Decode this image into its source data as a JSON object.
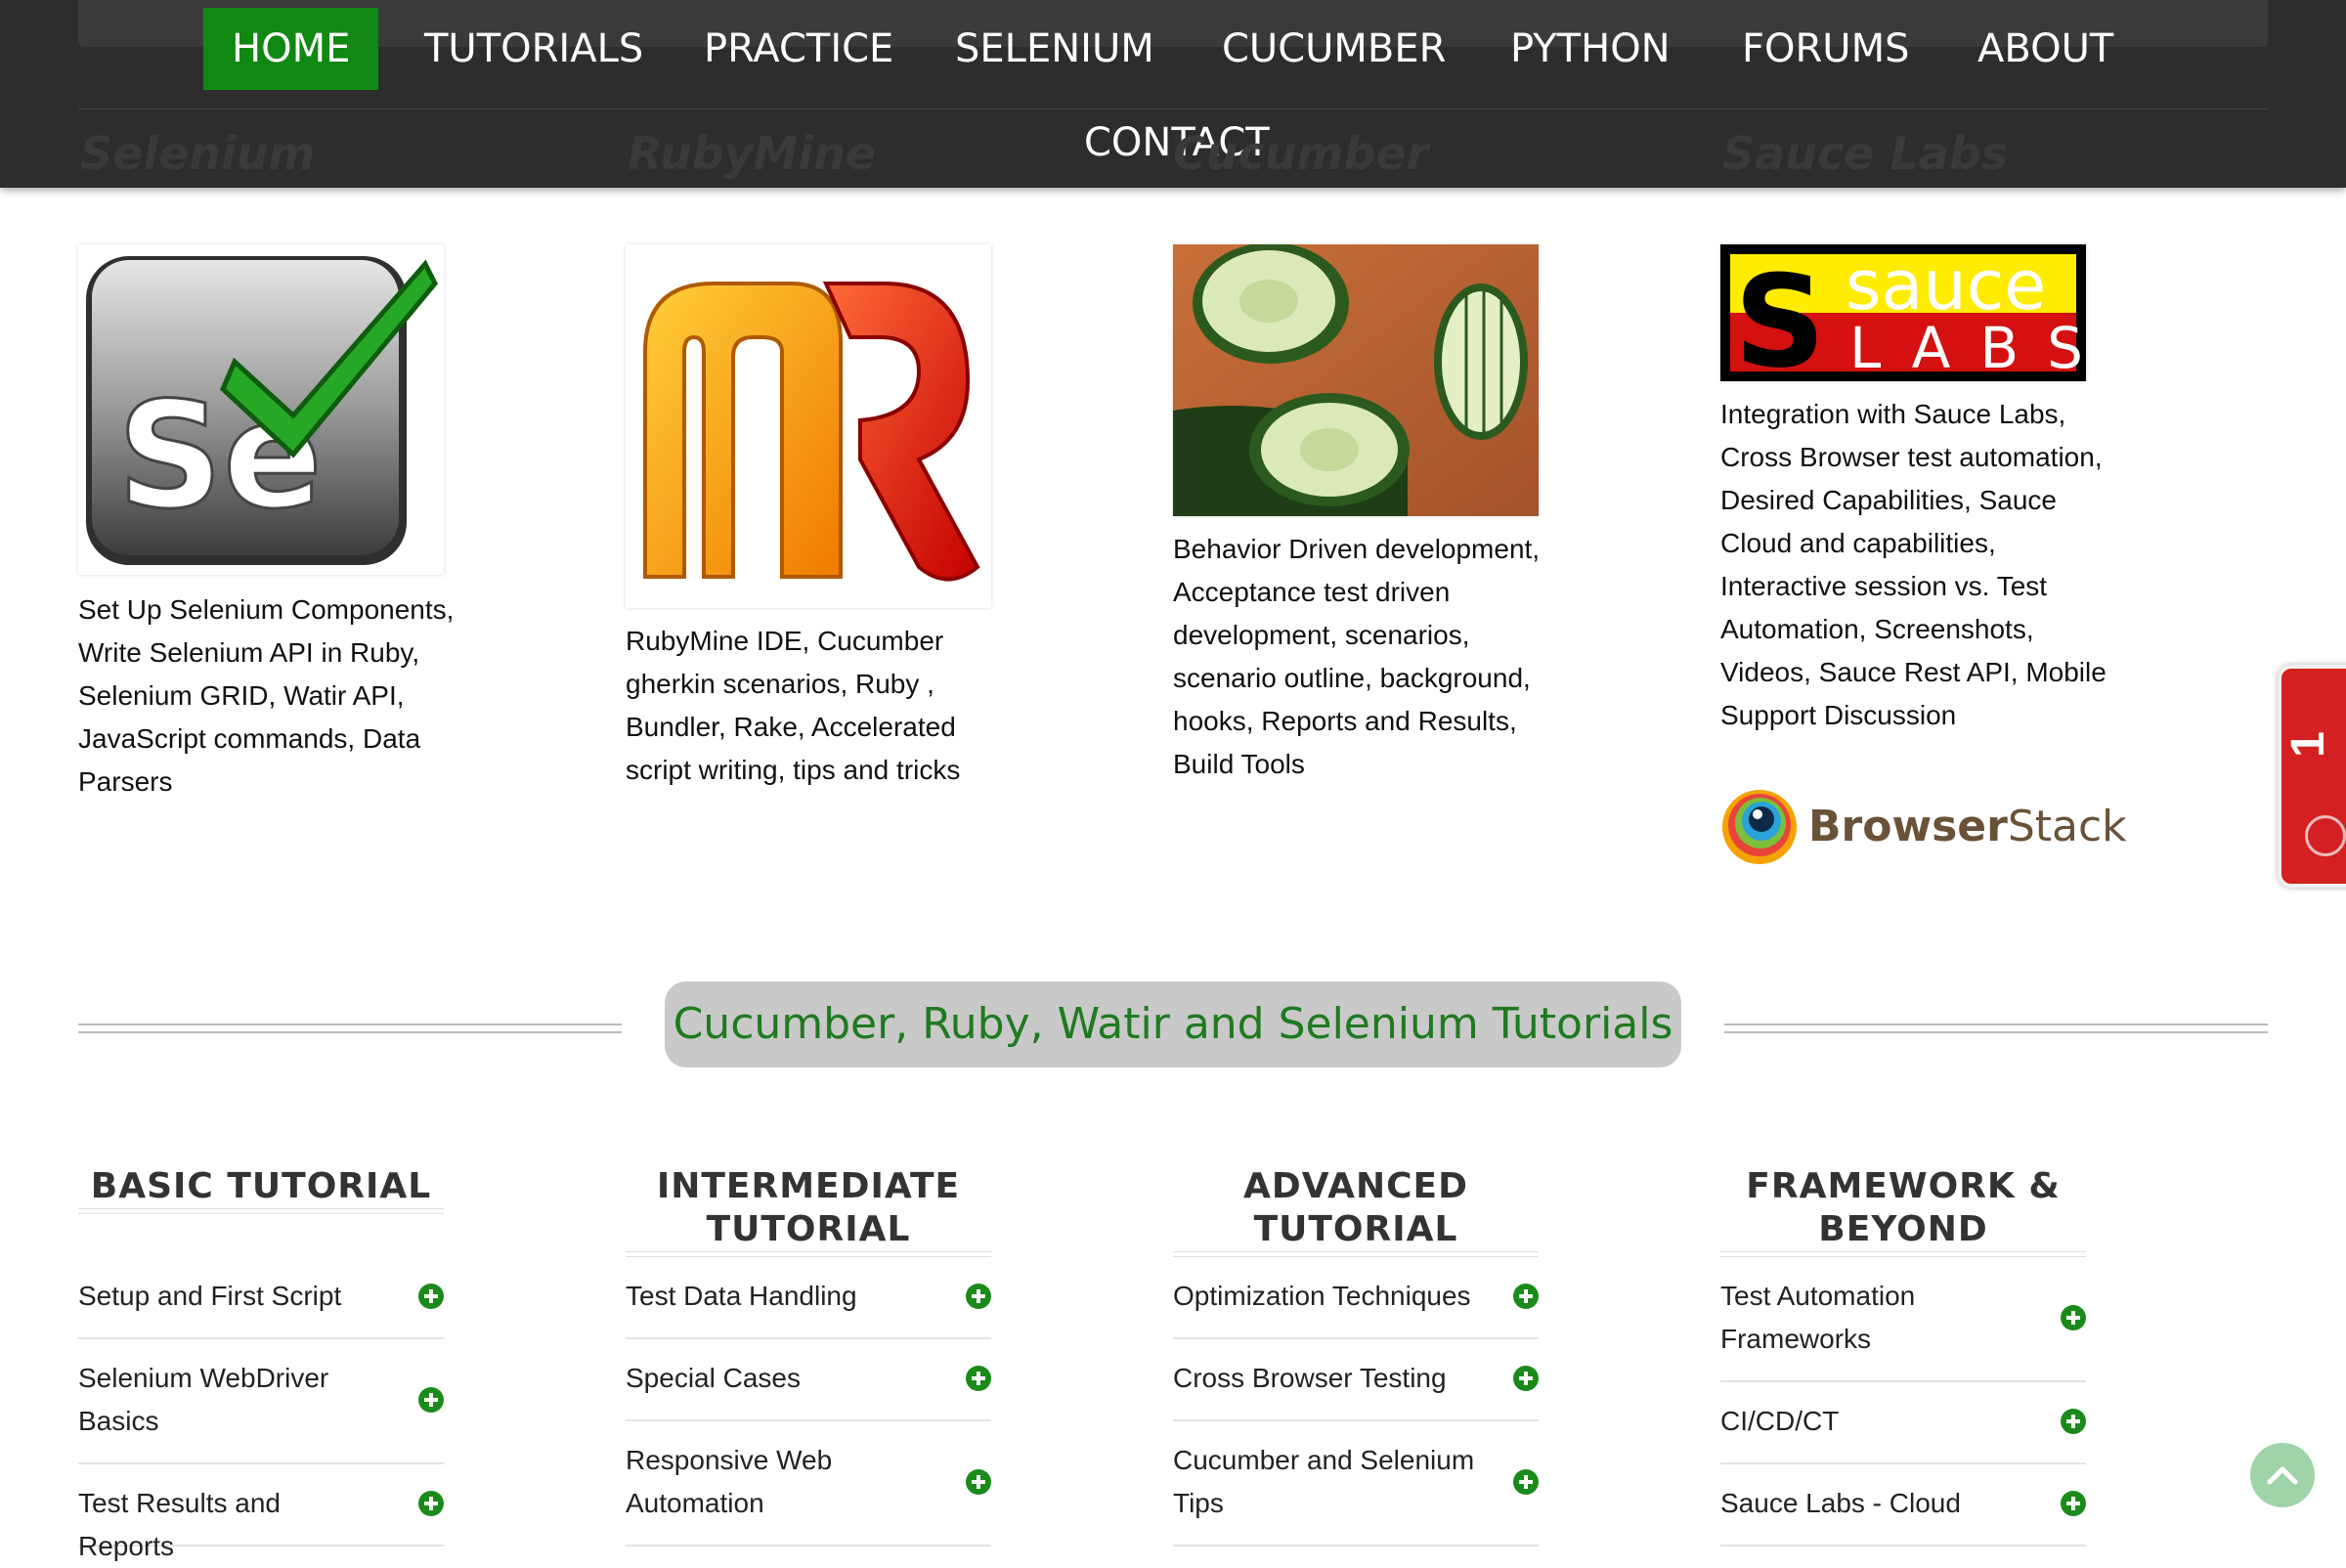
{
  "nav": {
    "items": [
      "HOME",
      "TUTORIALS",
      "PRACTICE",
      "SELENIUM",
      "CUCUMBER",
      "PYTHON",
      "FORUMS",
      "ABOUT"
    ],
    "contact": "CONTACT",
    "active": "HOME"
  },
  "features": [
    {
      "title": "Selenium",
      "image": "selenium-logo",
      "text": "Set Up Selenium Components, Write Selenium API in Ruby, Selenium GRID, Watir API, JavaScript commands, Data Parsers"
    },
    {
      "title": "RubyMine",
      "image": "rubymine-logo",
      "text": "RubyMine IDE, Cucumber gherkin scenarios, Ruby , Bundler, Rake, Accelerated script writing, tips and tricks"
    },
    {
      "title": "Cucumber",
      "image": "cucumber-photo",
      "text": "Behavior Driven development, Acceptance test driven development, scenarios, scenario outline, background, hooks, Reports and Results, Build Tools"
    },
    {
      "title": "Sauce Labs",
      "image": "saucelabs-logo",
      "text": "Integration with Sauce Labs, Cross Browser test automation, Desired Capabilities, Sauce Cloud and capabilities, Interactive session vs. Test Automation, Screenshots, Videos, Sauce Rest API, Mobile Support Discussion"
    }
  ],
  "saucelabs_logo": {
    "word1": "sauce",
    "word2": "LABS",
    "letter": "S"
  },
  "browserstack": {
    "prefix": "Browser",
    "suffix": "Stack"
  },
  "section_title": "Cucumber, Ruby, Watir and Selenium Tutorials",
  "columns": [
    {
      "heading": "BASIC TUTORIAL",
      "items": [
        "Setup and First Script",
        "Selenium WebDriver Basics",
        "Test Results and Reports"
      ]
    },
    {
      "heading": "INTERMEDIATE TUTORIAL",
      "items": [
        "Test Data Handling",
        "Special Cases",
        "Responsive Web Automation"
      ]
    },
    {
      "heading": "ADVANCED TUTORIAL",
      "items": [
        "Optimization Techniques",
        "Cross Browser Testing",
        "Cucumber and Selenium Tips"
      ]
    },
    {
      "heading": "FRAMEWORK & BEYOND",
      "items": [
        "Test Automation Frameworks",
        "CI/CD/CT",
        "Sauce Labs - Cloud"
      ]
    }
  ],
  "side_tab": {
    "label": "1"
  },
  "colors": {
    "accent_green": "#118811",
    "header_bg": "#2d2d2d",
    "side_tab": "#d42020"
  }
}
